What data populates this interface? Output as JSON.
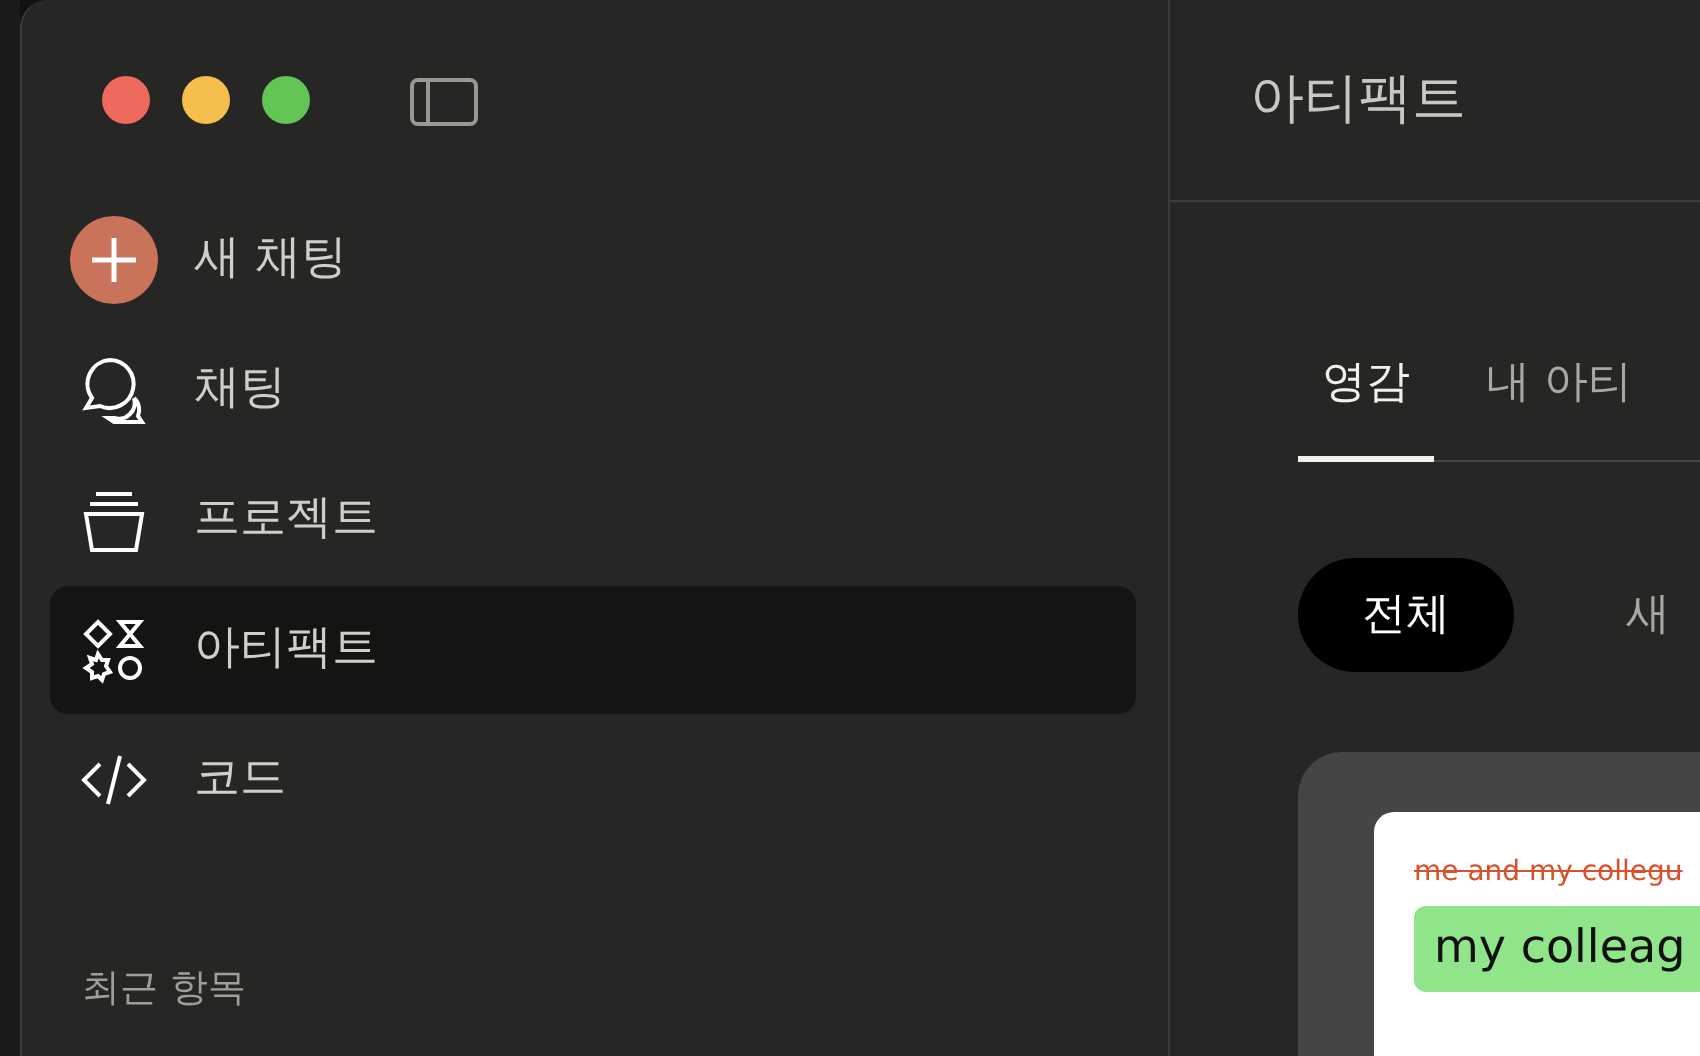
{
  "window": {
    "controls": [
      {
        "color": "#ee6a5f"
      },
      {
        "color": "#f5be4f"
      },
      {
        "color": "#62c554"
      }
    ]
  },
  "sidebar": {
    "items": [
      {
        "kind": "new",
        "label": "새 채팅",
        "selected": false
      },
      {
        "kind": "chat",
        "label": "채팅",
        "selected": false
      },
      {
        "kind": "project",
        "label": "프로젝트",
        "selected": false
      },
      {
        "kind": "artifact",
        "label": "아티팩트",
        "selected": true
      },
      {
        "kind": "code",
        "label": "코드",
        "selected": false
      }
    ],
    "section_heading": "최근 항목"
  },
  "main": {
    "title": "아티팩트",
    "tabs": [
      {
        "label": "영감",
        "selected": true
      },
      {
        "label": "내 아티",
        "selected": false
      }
    ],
    "filters": [
      {
        "label": "전체",
        "selected": true
      },
      {
        "label": "새",
        "selected": false
      }
    ],
    "preview_card": {
      "struck_text": "me and my collegu",
      "highlighted_text": "my colleag"
    }
  }
}
